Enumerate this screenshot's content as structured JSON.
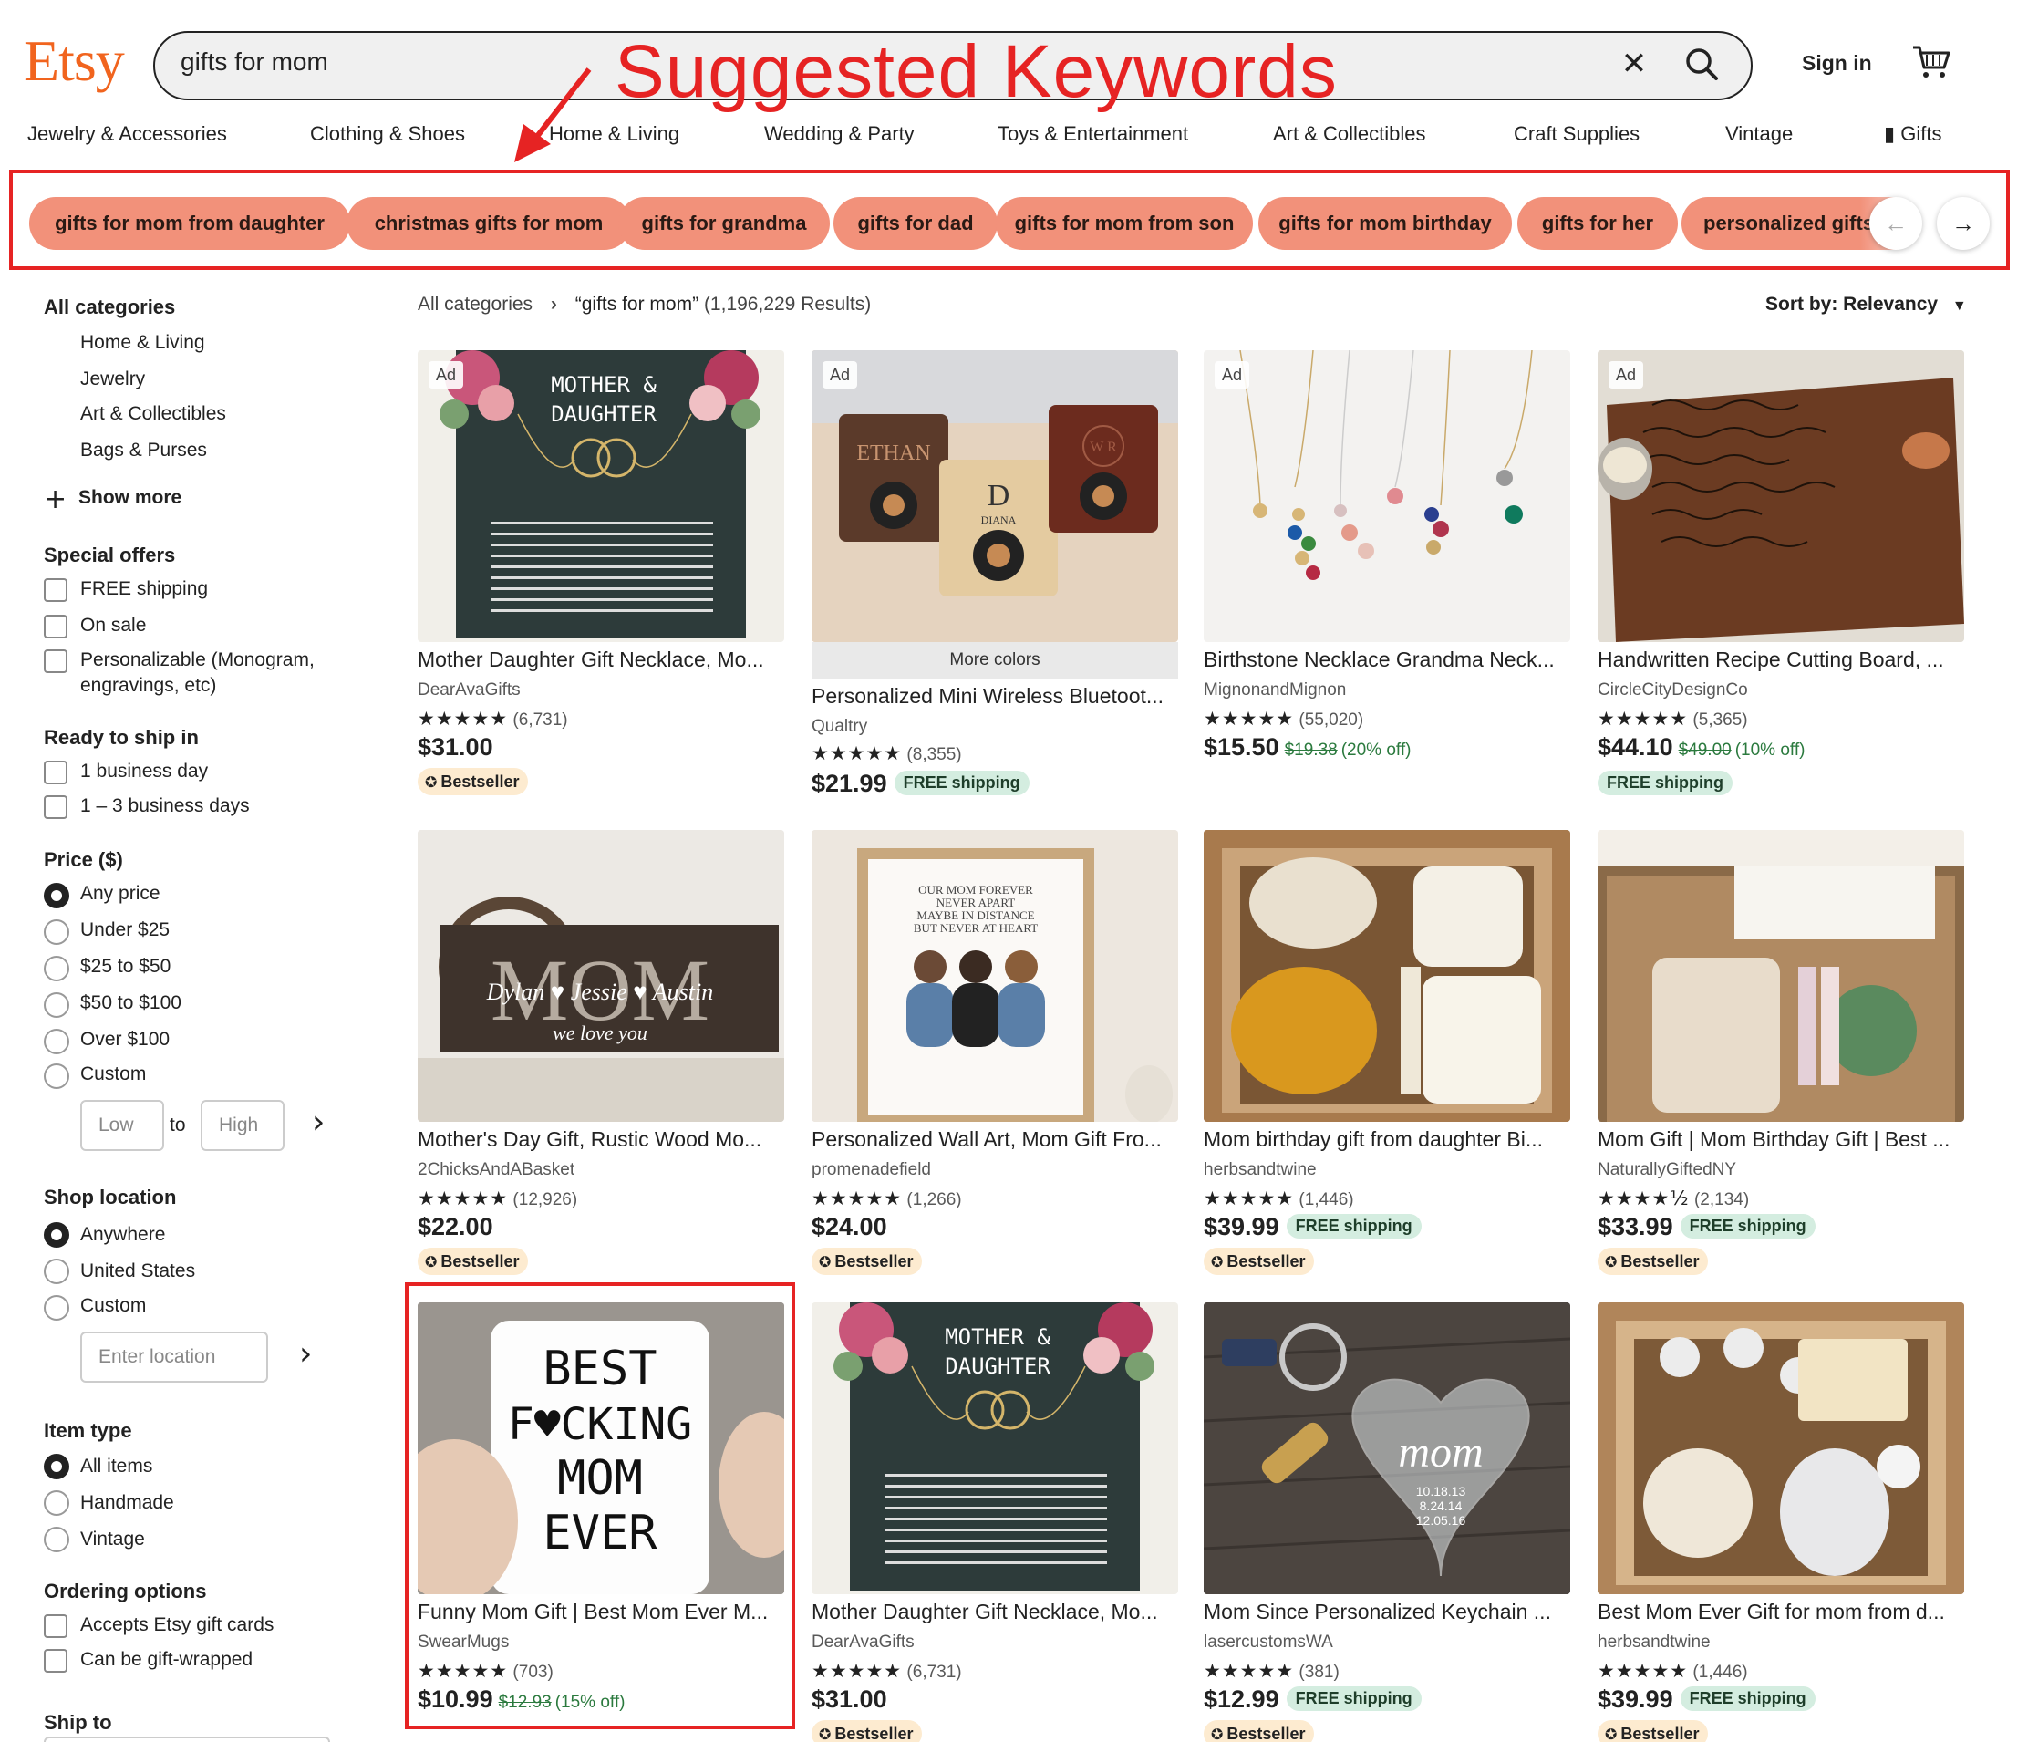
{
  "header": {
    "logo": "Etsy",
    "search_value": "gifts for mom",
    "sign_in": "Sign in"
  },
  "annotation": {
    "title": "Suggested Keywords"
  },
  "nav": [
    "Jewelry & Accessories",
    "Clothing & Shoes",
    "Home & Living",
    "Wedding & Party",
    "Toys & Entertainment",
    "Art & Collectibles",
    "Craft Supplies",
    "Vintage",
    "Gifts"
  ],
  "keywords": [
    "gifts for mom from daughter",
    "christmas gifts for mom",
    "gifts for grandma",
    "gifts for dad",
    "gifts for mom from son",
    "gifts for mom birthday",
    "gifts for her",
    "personalized gifts"
  ],
  "sidebar": {
    "all_categories": "All categories",
    "categories": [
      "Home & Living",
      "Jewelry",
      "Art & Collectibles",
      "Bags & Purses"
    ],
    "show_more": "Show more",
    "special_offers": {
      "title": "Special offers",
      "options": [
        "FREE shipping",
        "On sale",
        "Personalizable (Monogram,",
        "engravings, etc)"
      ]
    },
    "ready_to_ship": {
      "title": "Ready to ship in",
      "options": [
        "1 business day",
        "1 – 3 business days"
      ]
    },
    "price": {
      "title": "Price ($)",
      "options": [
        "Any price",
        "Under $25",
        "$25 to $50",
        "$50 to $100",
        "Over $100",
        "Custom"
      ],
      "low_placeholder": "Low",
      "to": "to",
      "high_placeholder": "High"
    },
    "shop_location": {
      "title": "Shop location",
      "options": [
        "Anywhere",
        "United States",
        "Custom"
      ],
      "location_placeholder": "Enter location"
    },
    "item_type": {
      "title": "Item type",
      "options": [
        "All items",
        "Handmade",
        "Vintage"
      ]
    },
    "ordering_options": {
      "title": "Ordering options",
      "options": [
        "Accepts Etsy gift cards",
        "Can be gift-wrapped"
      ]
    },
    "ship_to": "Ship to"
  },
  "results": {
    "crumb_root": "All categories",
    "crumb_query": "“gifts for mom”",
    "crumb_count": "(1,196,229 Results)",
    "sort": "Sort by: Relevancy"
  },
  "labels": {
    "ad": "Ad",
    "more_colors": "More colors",
    "bestseller": "Bestseller",
    "free_shipping": "FREE shipping"
  },
  "products": [
    {
      "title": "Mother Daughter Gift Necklace, Mo...",
      "shop": "DearAvaGifts",
      "rating": "(6,731)",
      "price": "$31.00",
      "orig": "",
      "off": "",
      "free": false,
      "bestseller": true,
      "ad": true
    },
    {
      "title": "Personalized Mini Wireless Bluetoot...",
      "shop": "Qualtry",
      "rating": "(8,355)",
      "price": "$21.99",
      "orig": "",
      "off": "",
      "free": true,
      "bestseller": false,
      "ad": true
    },
    {
      "title": "Birthstone Necklace Grandma Neck...",
      "shop": "MignonandMignon",
      "rating": "(55,020)",
      "price": "$15.50",
      "orig": "$19.38",
      "off": "(20% off)",
      "free": false,
      "bestseller": false,
      "ad": true
    },
    {
      "title": "Handwritten Recipe Cutting Board, ...",
      "shop": "CircleCityDesignCo",
      "rating": "(5,365)",
      "price": "$44.10",
      "orig": "$49.00",
      "off": "(10% off)",
      "free": true,
      "bestseller": false,
      "ad": true
    },
    {
      "title": "Mother's Day Gift, Rustic Wood Mo...",
      "shop": "2ChicksAndABasket",
      "rating": "(12,926)",
      "price": "$22.00",
      "orig": "",
      "off": "",
      "free": false,
      "bestseller": true,
      "ad": false
    },
    {
      "title": "Personalized Wall Art, Mom Gift Fro...",
      "shop": "promenadefield",
      "rating": "(1,266)",
      "price": "$24.00",
      "orig": "",
      "off": "",
      "free": false,
      "bestseller": true,
      "ad": false
    },
    {
      "title": "Mom birthday gift from daughter Bi...",
      "shop": "herbsandtwine",
      "rating": "(1,446)",
      "price": "$39.99",
      "orig": "",
      "off": "",
      "free": true,
      "bestseller": true,
      "ad": false
    },
    {
      "title": "Mom Gift | Mom Birthday Gift | Best ...",
      "shop": "NaturallyGiftedNY",
      "rating": "(2,134)",
      "price": "$33.99",
      "orig": "",
      "off": "",
      "free": true,
      "bestseller": true,
      "ad": false
    },
    {
      "title": "Funny Mom Gift | Best Mom Ever M...",
      "shop": "SwearMugs",
      "rating": "(703)",
      "price": "$10.99",
      "orig": "$12.93",
      "off": "(15% off)",
      "free": false,
      "bestseller": false,
      "ad": false
    },
    {
      "title": "Mother Daughter Gift Necklace, Mo...",
      "shop": "DearAvaGifts",
      "rating": "(6,731)",
      "price": "$31.00",
      "orig": "",
      "off": "",
      "free": false,
      "bestseller": true,
      "ad": false
    },
    {
      "title": "Mom Since Personalized Keychain ...",
      "shop": "lasercustomsWA",
      "rating": "(381)",
      "price": "$12.99",
      "orig": "",
      "off": "",
      "free": true,
      "bestseller": true,
      "ad": false
    },
    {
      "title": "Best Mom Ever Gift for mom from d...",
      "shop": "herbsandtwine",
      "rating": "(1,446)",
      "price": "$39.99",
      "orig": "",
      "off": "",
      "free": true,
      "bestseller": true,
      "ad": false
    }
  ],
  "image_text": {
    "card1": [
      "MOTHER &",
      "DAUGHTER"
    ],
    "card2": [
      "ETHAN",
      "D",
      "DIANA",
      "W R"
    ],
    "card5": [
      "MOM",
      "Dylan ♥ Jessie ♥ Austin",
      "we love you"
    ],
    "card6": [
      "OUR MOM FOREVER",
      "NEVER APART",
      "MAYBE IN DISTANCE",
      "BUT NEVER AT HEART"
    ],
    "card9": [
      "BEST",
      "F♥CKING",
      "MOM",
      "EVER"
    ],
    "card11": [
      "mom",
      "10.18.13",
      "8.24.14",
      "12.05.16"
    ]
  },
  "colors": {
    "brand": "#f1641e",
    "chip": "#f2917a",
    "annotation": "#e62323"
  }
}
